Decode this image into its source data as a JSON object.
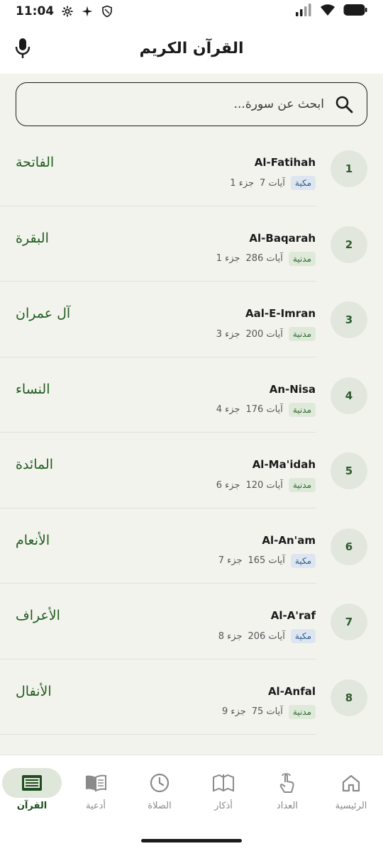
{
  "status_bar": {
    "time": "11:04"
  },
  "header": {
    "title": "القرآن الكريم",
    "mic_icon": "microphone-icon"
  },
  "search": {
    "placeholder": "ابحث عن سورة..."
  },
  "surahs": [
    {
      "number": "1",
      "name_en": "Al-Fatihah",
      "type": "مكية",
      "type_key": "makki",
      "ayat": "7 آيات",
      "juz": "جزء 1",
      "name_ar": "الفاتحة"
    },
    {
      "number": "2",
      "name_en": "Al-Baqarah",
      "type": "مدنية",
      "type_key": "madani",
      "ayat": "286 آيات",
      "juz": "جزء 1",
      "name_ar": "البقرة"
    },
    {
      "number": "3",
      "name_en": "Aal-E-Imran",
      "type": "مدنية",
      "type_key": "madani",
      "ayat": "200 آيات",
      "juz": "جزء 3",
      "name_ar": "آل عمران"
    },
    {
      "number": "4",
      "name_en": "An-Nisa",
      "type": "مدنية",
      "type_key": "madani",
      "ayat": "176 آيات",
      "juz": "جزء 4",
      "name_ar": "النساء"
    },
    {
      "number": "5",
      "name_en": "Al-Ma'idah",
      "type": "مدنية",
      "type_key": "madani",
      "ayat": "120 آيات",
      "juz": "جزء 6",
      "name_ar": "المائدة"
    },
    {
      "number": "6",
      "name_en": "Al-An'am",
      "type": "مكية",
      "type_key": "makki",
      "ayat": "165 آيات",
      "juz": "جزء 7",
      "name_ar": "الأنعام"
    },
    {
      "number": "7",
      "name_en": "Al-A'raf",
      "type": "مكية",
      "type_key": "makki",
      "ayat": "206 آيات",
      "juz": "جزء 8",
      "name_ar": "الأعراف"
    },
    {
      "number": "8",
      "name_en": "Al-Anfal",
      "type": "مدنية",
      "type_key": "madani",
      "ayat": "75 آيات",
      "juz": "جزء 9",
      "name_ar": "الأنفال"
    }
  ],
  "nav": [
    {
      "label": "القرآن",
      "icon": "quran-book-icon",
      "active": true
    },
    {
      "label": "أدعية",
      "icon": "open-book-icon",
      "active": false
    },
    {
      "label": "الصلاة",
      "icon": "clock-icon",
      "active": false
    },
    {
      "label": "أذكار",
      "icon": "map-book-icon",
      "active": false
    },
    {
      "label": "العداد",
      "icon": "tap-hand-icon",
      "active": false
    },
    {
      "label": "الرئيسية",
      "icon": "home-icon",
      "active": false
    }
  ],
  "colors": {
    "accent": "#1f5d1f",
    "background": "#f3f3ee",
    "makki_badge": "#dde6f0",
    "madani_badge": "#dfe9da"
  }
}
